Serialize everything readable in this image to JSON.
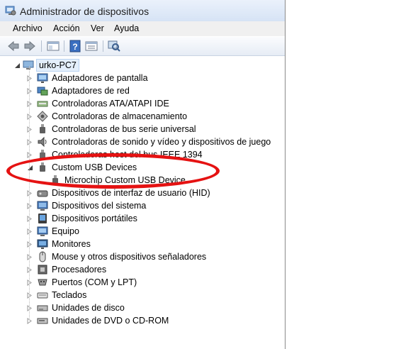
{
  "window": {
    "title": "Administrador de dispositivos"
  },
  "menu": [
    {
      "label": "Archivo"
    },
    {
      "label": "Acción"
    },
    {
      "label": "Ver"
    },
    {
      "label": "Ayuda"
    }
  ],
  "toolbar": {
    "icons": [
      "back-arrow-icon",
      "forward-arrow-icon",
      "show-hide-tree-icon",
      "help-icon",
      "properties-icon",
      "scan-hardware-icon"
    ]
  },
  "tree": {
    "root": {
      "label": "urko-PC7",
      "expanded": true
    },
    "categories": [
      {
        "label": "Adaptadores de pantalla",
        "icon": "display-adapter-icon"
      },
      {
        "label": "Adaptadores de red",
        "icon": "network-adapter-icon"
      },
      {
        "label": "Controladoras ATA/ATAPI IDE",
        "icon": "ide-controller-icon"
      },
      {
        "label": "Controladoras de almacenamiento",
        "icon": "storage-controller-icon"
      },
      {
        "label": "Controladoras de bus serie universal",
        "icon": "usb-plug-icon"
      },
      {
        "label": "Controladoras de sonido y vídeo y dispositivos de juego",
        "icon": "speaker-icon"
      },
      {
        "label": "Controladoras host del bus IEEE 1394",
        "icon": "ieee1394-icon"
      },
      {
        "label": "Custom USB Devices",
        "icon": "usb-plug-icon",
        "expanded": true,
        "children": [
          {
            "label": "Microchip Custom USB Device",
            "icon": "usb-plug-icon"
          }
        ]
      },
      {
        "label": "Dispositivos de interfaz de usuario (HID)",
        "icon": "hid-icon"
      },
      {
        "label": "Dispositivos del sistema",
        "icon": "system-devices-icon"
      },
      {
        "label": "Dispositivos portátiles",
        "icon": "portable-device-icon"
      },
      {
        "label": "Equipo",
        "icon": "computer-icon"
      },
      {
        "label": "Monitores",
        "icon": "monitor-icon"
      },
      {
        "label": "Mouse y otros dispositivos señaladores",
        "icon": "mouse-icon"
      },
      {
        "label": "Procesadores",
        "icon": "processor-icon"
      },
      {
        "label": "Puertos (COM y LPT)",
        "icon": "ports-icon"
      },
      {
        "label": "Teclados",
        "icon": "keyboard-icon"
      },
      {
        "label": "Unidades de disco",
        "icon": "disk-drive-icon"
      },
      {
        "label": "Unidades de DVD o CD-ROM",
        "icon": "dvd-drive-icon"
      }
    ]
  },
  "colors": {
    "annotation": "#e51212",
    "selection": "#e4effb"
  }
}
